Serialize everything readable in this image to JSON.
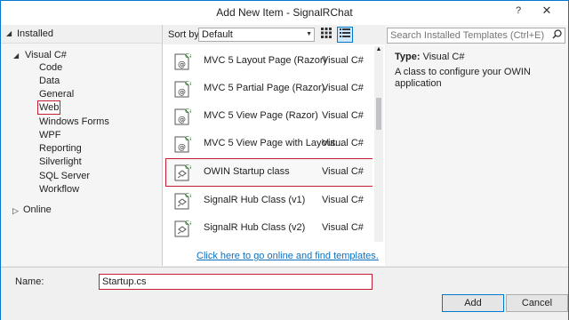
{
  "window": {
    "title": "Add New Item - SignalRChat",
    "help": "?",
    "close": "✕"
  },
  "left": {
    "installed": "Installed",
    "visual_csharp": "Visual C#",
    "items": [
      "Code",
      "Data",
      "General",
      "Web",
      "Windows Forms",
      "WPF",
      "Reporting",
      "Silverlight",
      "SQL Server",
      "Workflow"
    ],
    "selected": "Web",
    "online": "Online"
  },
  "center": {
    "sort_label": "Sort by:",
    "sort_value": "Default",
    "templates": [
      {
        "name": "MVC 5 Layout Page (Razor)",
        "lang": "Visual C#",
        "icon": "mvc-view-icon"
      },
      {
        "name": "MVC 5 Partial Page (Razor)",
        "lang": "Visual C#",
        "icon": "mvc-view-icon"
      },
      {
        "name": "MVC 5 View Page (Razor)",
        "lang": "Visual C#",
        "icon": "mvc-view-icon"
      },
      {
        "name": "MVC 5 View Page with Layout...",
        "lang": "Visual C#",
        "icon": "mvc-view-icon"
      },
      {
        "name": "OWIN Startup class",
        "lang": "Visual C#",
        "icon": "csharp-class-icon"
      },
      {
        "name": "SignalR Hub Class (v1)",
        "lang": "Visual C#",
        "icon": "csharp-class-icon"
      },
      {
        "name": "SignalR Hub Class (v2)",
        "lang": "Visual C#",
        "icon": "csharp-class-icon"
      }
    ],
    "selected_index": 4,
    "online_link": "Click here to go online and find templates."
  },
  "right": {
    "search_placeholder": "Search Installed Templates (Ctrl+E)",
    "type_label": "Type:",
    "type_value": "Visual C#",
    "description": "A class to configure your OWIN application"
  },
  "bottom": {
    "name_label": "Name:",
    "name_value": "Startup.cs",
    "add_label": "Add",
    "cancel_label": "Cancel"
  },
  "colors": {
    "accent": "#007acc",
    "highlight_border": "#c02030",
    "link": "#0e70c0"
  }
}
